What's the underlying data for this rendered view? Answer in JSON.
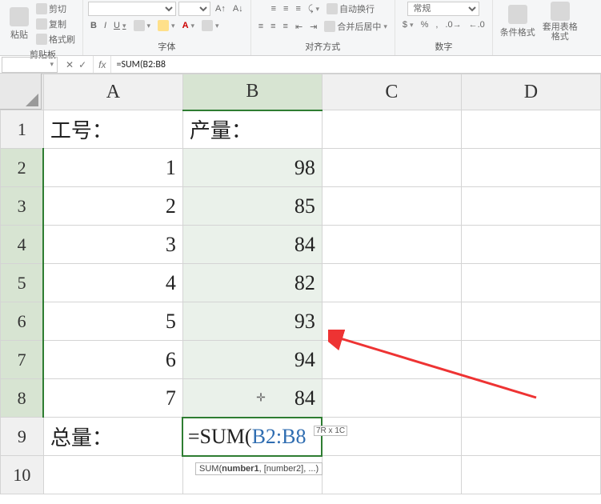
{
  "ribbon": {
    "clipboard": {
      "cut": "剪切",
      "copy": "复制",
      "painter": "格式刷",
      "paste": "粘贴",
      "label": "剪贴板"
    },
    "font": {
      "bold": "B",
      "italic": "I",
      "underline": "U",
      "label": "字体"
    },
    "align": {
      "wrap": "自动换行",
      "merge": "合并后居中",
      "label": "对齐方式"
    },
    "number": {
      "general": "常规",
      "label": "数字"
    },
    "styles": {
      "cond": "条件格式",
      "table": "套用表格格式"
    }
  },
  "formulaBar": {
    "namebox": "",
    "cancel": "✕",
    "enter": "✓",
    "fx": "fx",
    "formula": "=SUM(B2:B8"
  },
  "columns": [
    "A",
    "B",
    "C",
    "D"
  ],
  "rows": [
    "1",
    "2",
    "3",
    "4",
    "5",
    "6",
    "7",
    "8",
    "9",
    "10"
  ],
  "cells": {
    "A1": "工号：",
    "B1": "产量：",
    "A2": "1",
    "B2": "98",
    "A3": "2",
    "B3": "85",
    "A4": "3",
    "B4": "84",
    "A5": "4",
    "B5": "82",
    "A6": "5",
    "B6": "93",
    "A7": "6",
    "B7": "94",
    "A8": "7",
    "B8": "84",
    "A9": "总量：",
    "B9_prefix": "=SUM(",
    "B9_ref": "B2:B8"
  },
  "badge": "7R x 1C",
  "hint_pre": "SUM(",
  "hint_b": "number1",
  "hint_post": ", [number2], ...)",
  "cursor": "✛"
}
